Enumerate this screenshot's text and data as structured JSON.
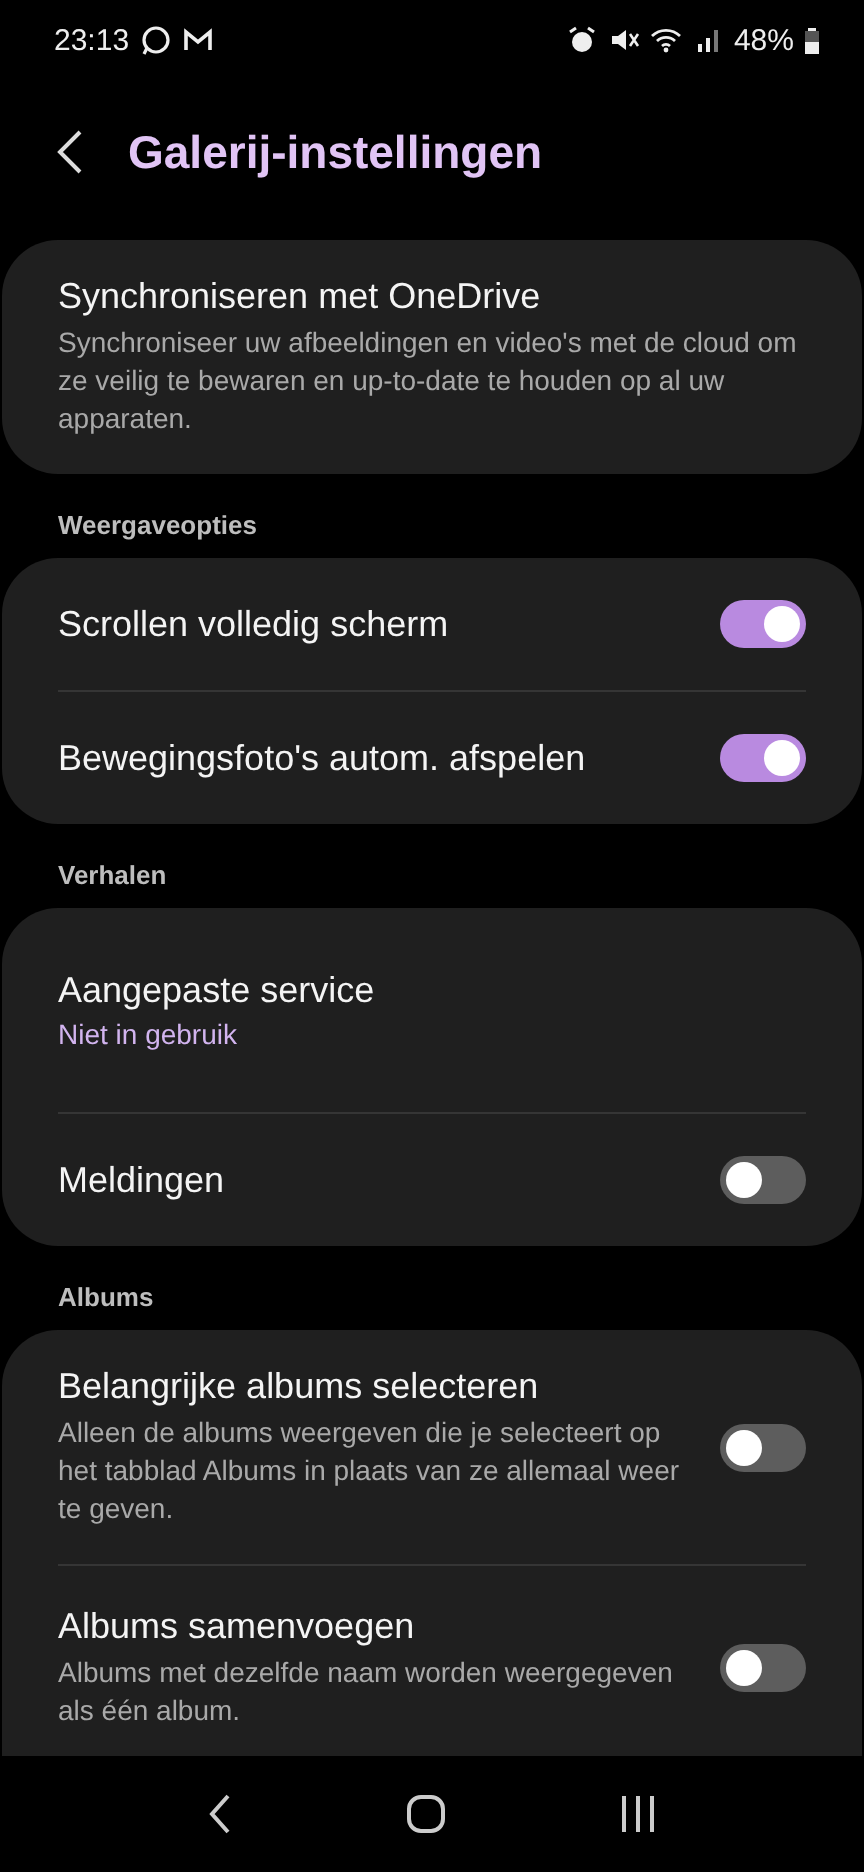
{
  "status_bar": {
    "time": "23:13",
    "battery": "48%"
  },
  "header": {
    "title": "Galerij-instellingen"
  },
  "sections": [
    {
      "items": [
        {
          "kind": "link",
          "title": "Synchroniseren met OneDrive",
          "subtitle": "Synchroniseer uw afbeeldingen en video's met de cloud om ze veilig te bewaren en up-to-date te houden op al uw apparaten."
        }
      ]
    },
    {
      "heading": "Weergaveopties",
      "items": [
        {
          "kind": "toggle",
          "title": "Scrollen volledig scherm",
          "on": true
        },
        {
          "kind": "toggle",
          "title": "Bewegingsfoto's autom. afspelen",
          "on": true
        }
      ]
    },
    {
      "heading": "Verhalen",
      "items": [
        {
          "kind": "link",
          "title": "Aangepaste service",
          "value": "Niet in gebruik"
        },
        {
          "kind": "toggle",
          "title": "Meldingen",
          "on": false
        }
      ]
    },
    {
      "heading": "Albums",
      "items": [
        {
          "kind": "toggle",
          "title": "Belangrijke albums selecteren",
          "subtitle": "Alleen de albums weergeven die je selecteert op het tabblad Albums in plaats van ze allemaal weer te geven.",
          "on": false
        },
        {
          "kind": "toggle",
          "title": "Albums samenvoegen",
          "subtitle": "Albums met dezelfde naam worden weergegeven als één album.",
          "on": false
        }
      ]
    }
  ]
}
